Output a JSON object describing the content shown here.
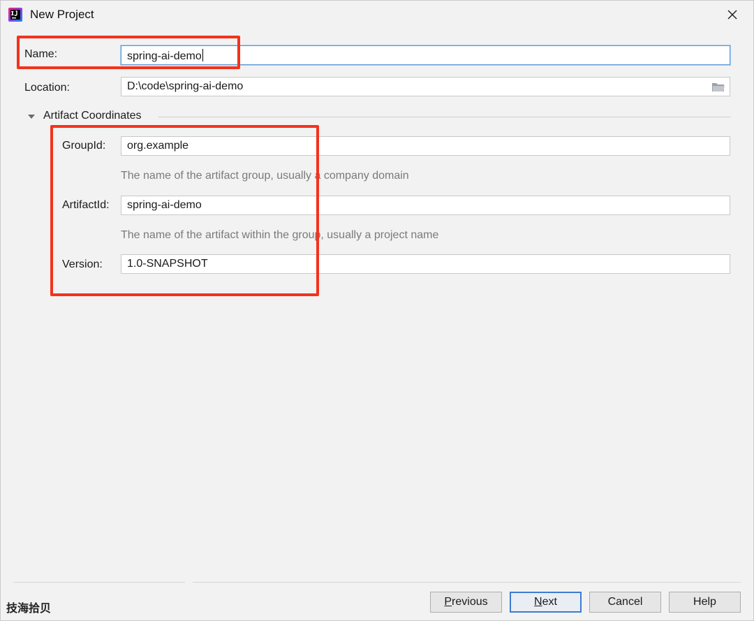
{
  "window": {
    "title": "New Project",
    "app_icon": "intellij-idea-icon",
    "close_icon": "close-icon"
  },
  "form": {
    "name": {
      "label": "Name:",
      "value": "spring-ai-demo"
    },
    "location": {
      "label": "Location:",
      "value": "D:\\code\\spring-ai-demo",
      "browse_icon": "folder-icon"
    },
    "artifact_section": {
      "label": "Artifact Coordinates",
      "expanded": true,
      "group_id": {
        "label": "GroupId:",
        "value": "org.example",
        "hint": "The name of the artifact group, usually a company domain"
      },
      "artifact_id": {
        "label": "ArtifactId:",
        "value": "spring-ai-demo",
        "hint": "The name of the artifact within the group, usually a project name"
      },
      "version": {
        "label": "Version:",
        "value": "1.0-SNAPSHOT"
      }
    }
  },
  "footer": {
    "watermark": "技海拾贝",
    "buttons": {
      "previous": {
        "mnemonic": "P",
        "rest": "revious"
      },
      "next": {
        "mnemonic": "N",
        "rest": "ext"
      },
      "cancel": "Cancel",
      "help": "Help"
    }
  },
  "colors": {
    "annotation": "#f3331c",
    "focus": "#5b9bd5",
    "default_button_border": "#3c7bd2"
  }
}
